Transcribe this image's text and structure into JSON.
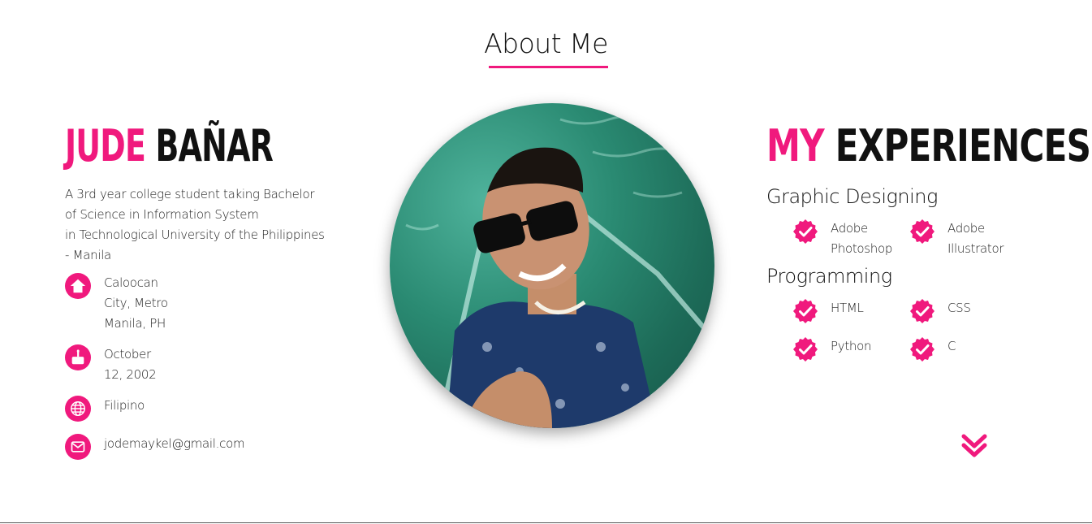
{
  "section": {
    "title": "About Me"
  },
  "profile": {
    "first_name": "JUDE",
    "last_name": "BAÑAR",
    "bio_lines": [
      "A 3rd year college student taking Bachelor",
      "of Science in Information System",
      "in Technological University of the Philippines",
      "- Manila"
    ],
    "info": [
      {
        "icon": "home-icon",
        "lines": [
          "Caloocan",
          "City, Metro",
          "Manila, PH"
        ]
      },
      {
        "icon": "birthday-cake-icon",
        "lines": [
          "October",
          "12, 2002"
        ]
      },
      {
        "icon": "globe-icon",
        "lines": [
          "Filipino"
        ]
      },
      {
        "icon": "envelope-icon",
        "lines": [
          "jodemaykel@gmail.com"
        ]
      }
    ]
  },
  "experiences": {
    "heading_accent": "MY",
    "heading_rest": "EXPERIENCES",
    "categories": [
      {
        "name": "Graphic Designing",
        "skills": [
          {
            "lines": [
              "Adobe",
              "Photoshop"
            ]
          },
          {
            "lines": [
              "Adobe",
              "Illustrator"
            ]
          }
        ]
      },
      {
        "name": "Programming",
        "skills": [
          {
            "lines": [
              "HTML"
            ]
          },
          {
            "lines": [
              "CSS"
            ]
          },
          {
            "lines": [
              "Python"
            ]
          },
          {
            "lines": [
              "C"
            ]
          }
        ]
      }
    ]
  },
  "icons": {
    "check": "check-badge-icon",
    "scroll": "double-chevron-down-icon"
  },
  "colors": {
    "accent": "#f0197d",
    "text": "#111111",
    "background": "#ffffff"
  }
}
